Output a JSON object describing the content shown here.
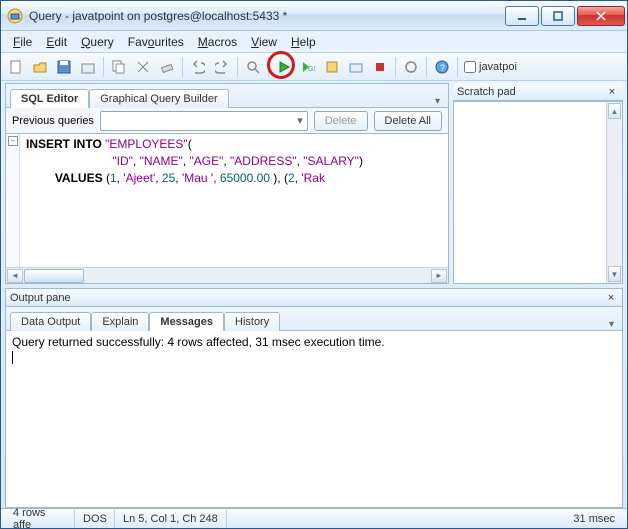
{
  "window": {
    "title": "Query - javatpoint on postgres@localhost:5433 *"
  },
  "menubar": {
    "file": "File",
    "edit": "Edit",
    "query": "Query",
    "favourites": "Favourites",
    "macros": "Macros",
    "view": "View",
    "help": "Help"
  },
  "toolbar": {
    "checkbox_label": "javatpoi"
  },
  "scratch": {
    "title": "Scratch pad",
    "close_glyph": "×"
  },
  "editor": {
    "tabs": {
      "sql": "SQL Editor",
      "gqb": "Graphical Query Builder",
      "arrow": "▾"
    },
    "prev": {
      "label": "Previous queries",
      "delete": "Delete",
      "delete_all": "Delete All",
      "combo_arrow": "▾"
    },
    "sql": {
      "l1a": "INSERT",
      "l1b": " INTO",
      "l1c": " \"EMPLOYEES\"",
      "l1d": "(",
      "l2a": "\"ID\"",
      "l2comma1": ", ",
      "l2b": "\"NAME\"",
      "l2comma2": ", ",
      "l2c": "\"AGE\"",
      "l2comma3": ", ",
      "l2d": "\"ADDRESS\"",
      "l2comma4": ", ",
      "l2e": "\"SALARY\"",
      "l2f": ")",
      "l3a": "VALUES",
      "l3b": " (",
      "l3c": "1",
      "l3d": ", ",
      "l3e": "'Ajeet'",
      "l3f": ", ",
      "l3g": "25",
      "l3h": ", ",
      "l3i": "'Mau '",
      "l3j": ", ",
      "l3k": "65000.00",
      "l3l": " ), (",
      "l3m": "2",
      "l3n": ", ",
      "l3o": "'Rak"
    }
  },
  "output": {
    "title": "Output pane",
    "close_glyph": "×",
    "tabs": {
      "data": "Data Output",
      "explain": "Explain",
      "messages": "Messages",
      "history": "History",
      "arrow": "▾"
    },
    "message": "Query returned successfully: 4 rows affected, 31 msec execution time."
  },
  "status": {
    "rows": "4 rows affe",
    "mode": "DOS",
    "pos": "Ln 5, Col 1, Ch 248",
    "time": "31 msec"
  }
}
